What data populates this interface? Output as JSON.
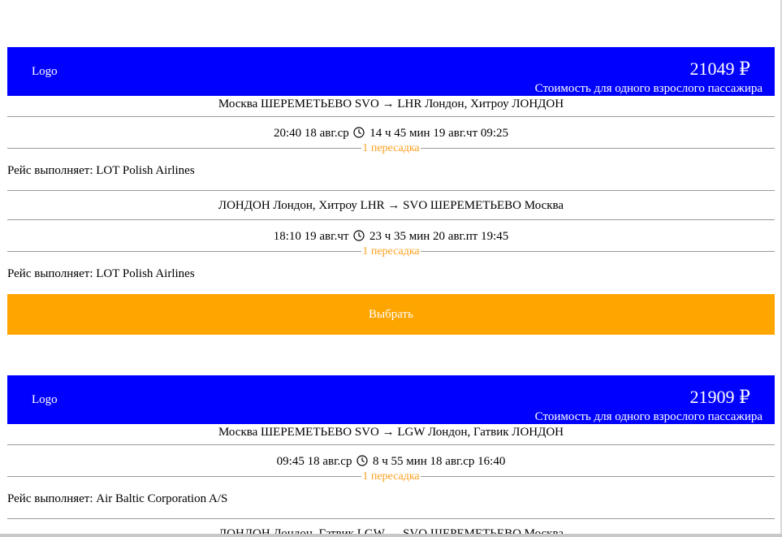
{
  "tickets": [
    {
      "logo": "Logo",
      "price": "21049 ₽",
      "price_note": "Стоимость для одного взрослого пассажира",
      "outbound": {
        "route": "Москва ШЕРЕМЕТЬЕВО SVO → LHR Лондон, Хитроу ЛОНДОН",
        "depart": "20:40 18 авг.ср",
        "duration": "14 ч 45 мин 19 авг.чт 09:25",
        "transfers": "1 пересадка",
        "carrier": "Рейс выполняет: LOT Polish Airlines"
      },
      "inbound": {
        "route": "ЛОНДОН Лондон, Хитроу LHR → SVO ШЕРЕМЕТЬЕВО Москва",
        "depart": "18:10 19 авг.чт",
        "duration": "23 ч 35 мин 20 авг.пт 19:45",
        "transfers": "1 пересадка",
        "carrier": "Рейс выполняет: LOT Polish Airlines"
      },
      "select_label": "Выбрать"
    },
    {
      "logo": "Logo",
      "price": "21909 ₽",
      "price_note": "Стоимость для одного взрослого пассажира",
      "outbound": {
        "route": "Москва ШЕРЕМЕТЬЕВО SVO → LGW Лондон, Гатвик ЛОНДОН",
        "depart": "09:45 18 авг.ср",
        "duration": "8 ч 55 мин 18 авг.ср 16:40",
        "transfers": "1 пересадка",
        "carrier": "Рейс выполняет: Air Baltic Corporation A/S"
      },
      "inbound": {
        "route": "ЛОНДОН Лондон, Гатвик LGW → SVO ШЕРЕМЕТЬЕВО Москва"
      }
    }
  ],
  "colors": {
    "header_bg": "#0000ff",
    "button_bg": "#ffa500",
    "transfer_text": "#ff9f1c"
  },
  "icons": {
    "duration": "clock-icon"
  }
}
